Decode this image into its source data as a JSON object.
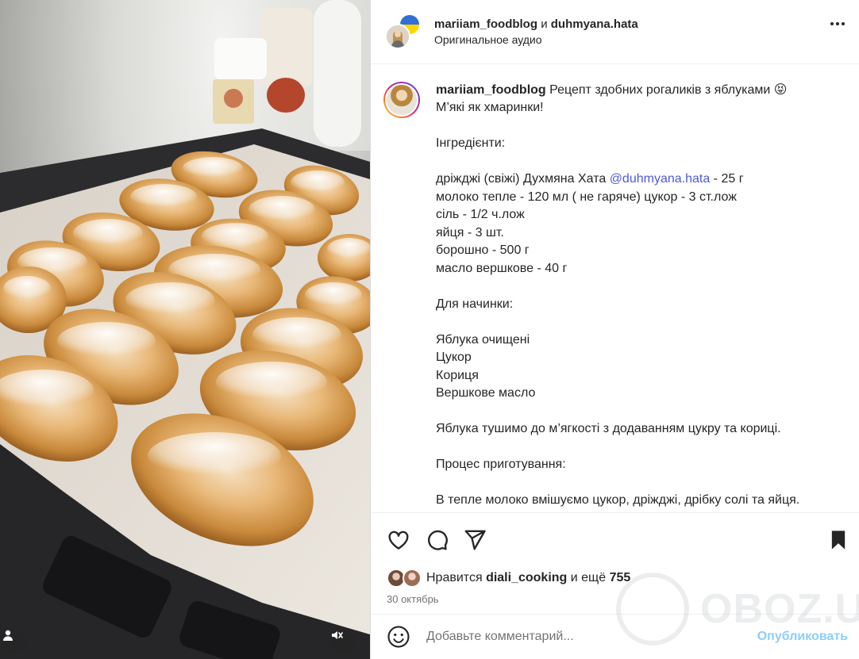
{
  "header": {
    "author1": "mariiam_foodblog",
    "conjunction": "и",
    "author2": "duhmyana.hata",
    "audio": "Оригинальное аудио"
  },
  "caption": {
    "username": "mariiam_foodblog",
    "title": "Рецепт здобних рогаликів з яблуками",
    "emoji": "😝",
    "line2": "М’які як хмаринки!",
    "ingredients_heading": "Інгредієнти:",
    "yeast_pre": "дріжджі (свіжі) Духмяна Хата ",
    "yeast_mention": "@duhmyana.hata",
    "yeast_post": " - 25 г",
    "milk": "молоко тепле - 120 мл ( не гаряче) цукор - 3 ст.лож",
    "salt": "сіль - 1/2 ч.лож",
    "eggs": "яйця - 3 шт.",
    "flour": "борошно - 500 г",
    "butter": "масло вершкове - 40 г",
    "filling_heading": "Для начинки:",
    "filling_1": "Яблука очищені",
    "filling_2": "Цукор",
    "filling_3": "Кориця",
    "filling_4": "Вершкове масло",
    "stew": "Яблука тушимо до м’ягкості з додаванням цукру та кориці.",
    "process_heading": "Процес приготування:",
    "process_1": "В тепле молоко вмішуємо цукор, дріжджі, дрібку солі та яйця."
  },
  "likes": {
    "prefix": "Нравится",
    "user": "diali_cooking",
    "middle": "и ещё",
    "count": "755"
  },
  "date": "30 октябрь",
  "comment": {
    "placeholder": "Добавьте комментарий...",
    "publish": "Опубликовать"
  },
  "watermark": "OBOZ.UA",
  "icons": [
    "heart-icon",
    "comment-icon",
    "share-icon",
    "bookmark-icon",
    "more-icon",
    "emoji-icon",
    "user-tag-icon",
    "mute-icon"
  ],
  "colors": {
    "link": "#4f5bd5",
    "publish": "#0095f6",
    "text": "#262626",
    "muted": "#737373"
  }
}
